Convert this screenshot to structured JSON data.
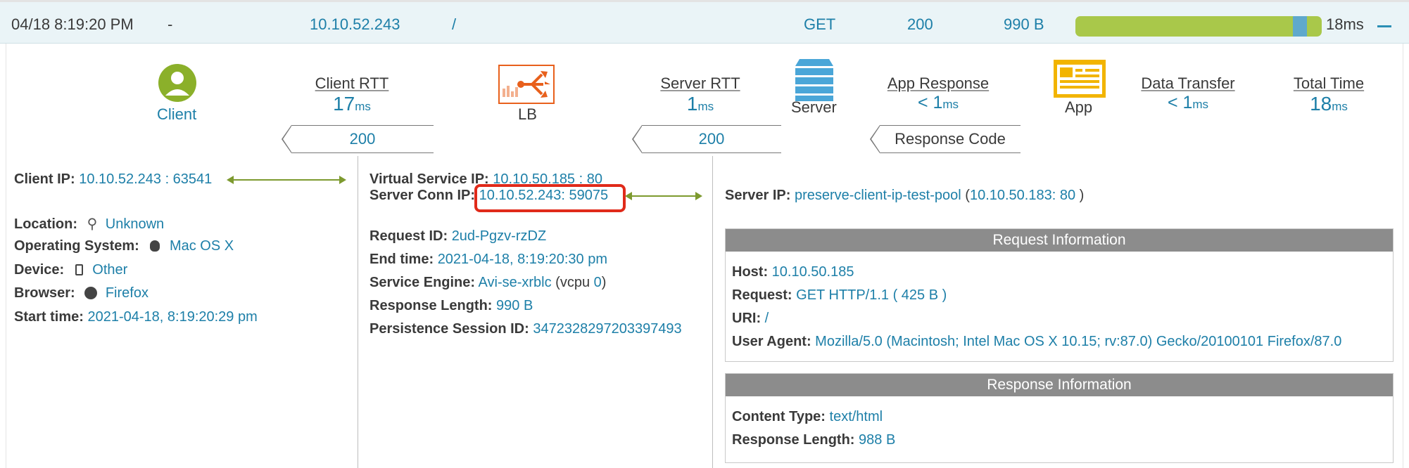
{
  "header": {
    "timestamp": "04/18 8:19:20 PM",
    "dash": "-",
    "client_ip": "10.10.52.243",
    "uri": "/",
    "method": "GET",
    "status": "200",
    "size": "990 B",
    "duration": "18ms"
  },
  "flow": {
    "client_label": "Client",
    "lb_label": "LB",
    "server_label": "Server",
    "app_label": "App",
    "client_rtt": {
      "label": "Client RTT",
      "value": "17",
      "unit": "ms"
    },
    "server_rtt": {
      "label": "Server RTT",
      "value": "1",
      "unit": "ms"
    },
    "app_response": {
      "label": "App Response",
      "value": "< 1",
      "unit": "ms"
    },
    "data_transfer": {
      "label": "Data Transfer",
      "value": "< 1",
      "unit": "ms"
    },
    "total_time": {
      "label": "Total Time",
      "value": "18",
      "unit": "ms"
    },
    "client_code": "200",
    "server_code": "200",
    "response_code_label": "Response Code"
  },
  "client": {
    "ip_label": "Client IP:",
    "ip": "10.10.52.243 : 63541",
    "location_label": "Location:",
    "location": "Unknown",
    "os_label": "Operating System:",
    "os": "Mac OS X",
    "device_label": "Device:",
    "device": "Other",
    "browser_label": "Browser:",
    "browser": "Firefox",
    "start_label": "Start time:",
    "start": "2021-04-18, 8:19:20:29 pm"
  },
  "lb": {
    "vs_ip_label": "Virtual Service IP:",
    "vs_ip": "10.10.50.185 : 80",
    "conn_ip_label": "Server Conn IP:",
    "conn_ip": "10.10.52.243: 59075",
    "request_id_label": "Request ID:",
    "request_id": "2ud-Pgzv-rzDZ",
    "end_label": "End time:",
    "end": "2021-04-18, 8:19:20:30 pm",
    "engine_label": "Service Engine:",
    "engine": "Avi-se-xrblc",
    "vcpu_prefix": "(vcpu",
    "vcpu": "0",
    "vcpu_suffix": ")",
    "resp_len_label": "Response Length:",
    "resp_len": "990 B",
    "persist_label": "Persistence Session ID:",
    "persist": "3472328297203397493"
  },
  "server": {
    "ip_label": "Server IP:",
    "pool": "preserve-client-ip-test-pool",
    "paren_open": "(",
    "ip": "10.10.50.183: 80",
    "paren_close": ")",
    "request_info": {
      "title": "Request Information",
      "host_label": "Host:",
      "host": "10.10.50.185",
      "request_label": "Request:",
      "request": "GET HTTP/1.1 ( 425 B )",
      "uri_label": "URI:",
      "uri": "/",
      "ua_label": "User Agent:",
      "ua": "Mozilla/5.0 (Macintosh; Intel Mac OS X 10.15; rv:87.0) Gecko/20100101 Firefox/87.0"
    },
    "response_info": {
      "title": "Response Information",
      "ctype_label": "Content Type:",
      "ctype": "text/html",
      "len_label": "Response Length:",
      "len": "988 B"
    }
  },
  "colors": {
    "accent": "#1d7fa8",
    "bar": "#a9c84a",
    "lb": "#e8601c",
    "client_icon": "#8bb02a",
    "server_icon": "#4aa6d8",
    "app_icon": "#f2b400",
    "highlight": "#e02a1a"
  },
  "progress_fraction": 0.94
}
